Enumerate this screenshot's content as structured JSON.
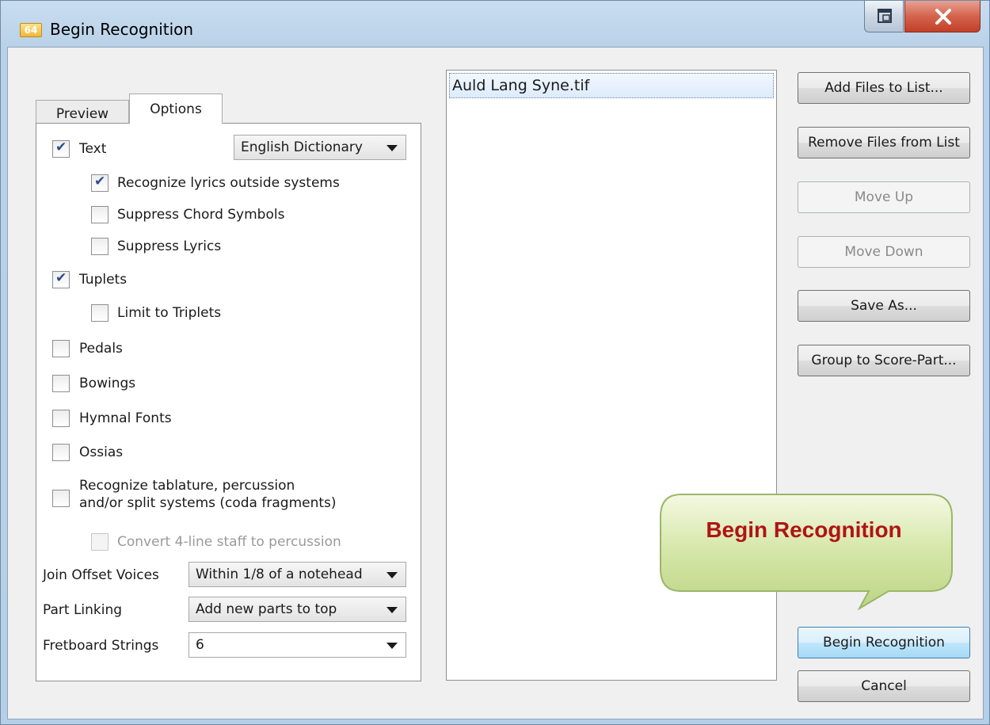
{
  "window": {
    "title": "Begin Recognition",
    "app_icon_text": "64"
  },
  "tabs": [
    {
      "label": "Preview",
      "active": false
    },
    {
      "label": "Options",
      "active": true
    }
  ],
  "options": {
    "text": {
      "label": "Text",
      "checked": true
    },
    "text_dictionary": "English Dictionary",
    "recognize_lyrics": {
      "label": "Recognize lyrics outside systems",
      "checked": true
    },
    "suppress_chords": {
      "label": "Suppress Chord Symbols",
      "checked": false
    },
    "suppress_lyrics": {
      "label": "Suppress Lyrics",
      "checked": false
    },
    "tuplets": {
      "label": "Tuplets",
      "checked": true
    },
    "limit_triplets": {
      "label": "Limit to Triplets",
      "checked": false
    },
    "pedals": {
      "label": "Pedals",
      "checked": false
    },
    "bowings": {
      "label": "Bowings",
      "checked": false
    },
    "hymnal_fonts": {
      "label": "Hymnal Fonts",
      "checked": false
    },
    "ossias": {
      "label": "Ossias",
      "checked": false
    },
    "tablature": {
      "label": "Recognize tablature, percussion\nand/or split systems (coda fragments)",
      "checked": false
    },
    "convert_4line": {
      "label": "Convert 4-line staff to percussion",
      "checked": false,
      "disabled": true
    },
    "join_offset": {
      "label": "Join Offset Voices",
      "value": "Within 1/8 of a notehead"
    },
    "part_linking": {
      "label": "Part Linking",
      "value": "Add new parts to top"
    },
    "fretboard": {
      "label": "Fretboard Strings",
      "value": "6"
    }
  },
  "file_list": {
    "items": [
      "Auld Lang Syne.tif"
    ]
  },
  "buttons": {
    "add_files": "Add Files to List...",
    "remove_files": "Remove Files from List",
    "move_up": "Move Up",
    "move_down": "Move Down",
    "save_as": "Save As...",
    "group": "Group to Score-Part...",
    "begin": "Begin Recognition",
    "cancel": "Cancel"
  },
  "callout": {
    "text": "Begin Recognition"
  }
}
